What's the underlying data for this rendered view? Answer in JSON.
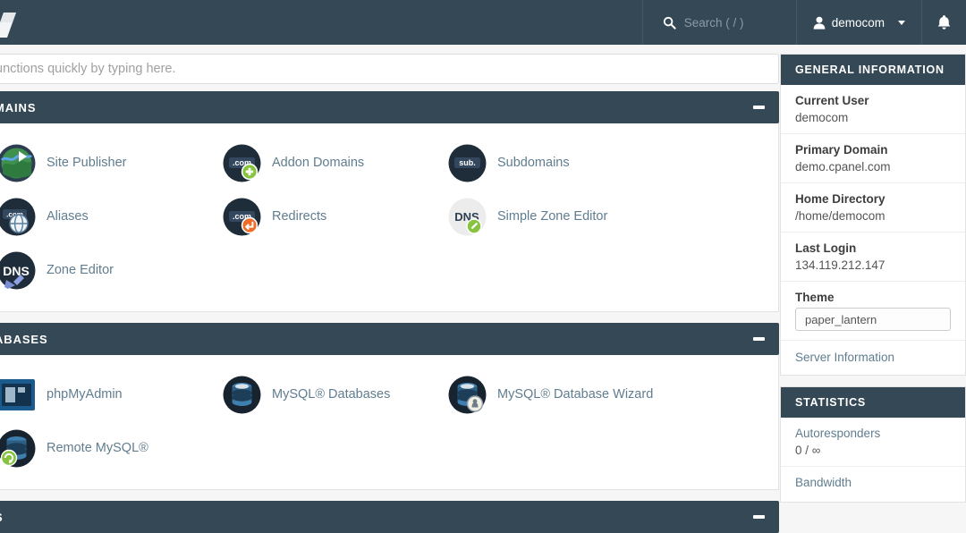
{
  "topnav": {
    "brand_icon": "cpanel-logo-icon",
    "search": {
      "icon": "search-icon",
      "placeholder": "Search ( / )"
    },
    "user": {
      "icon": "user-icon",
      "name": "democom",
      "caret_icon": "chevron-down-icon"
    },
    "notifications": {
      "icon": "bell-icon"
    }
  },
  "search_bar": {
    "placeholder": "functions quickly by typing here."
  },
  "sections": [
    {
      "title": "MAINS",
      "collapse_icon": "minus-icon",
      "tiles": [
        {
          "label": "Site Publisher",
          "icon": "site-publisher-icon"
        },
        {
          "label": "Addon Domains",
          "icon": "addon-domains-icon"
        },
        {
          "label": "Subdomains",
          "icon": "subdomains-icon"
        },
        {
          "label": "Aliases",
          "icon": "aliases-icon"
        },
        {
          "label": "Redirects",
          "icon": "redirects-icon"
        },
        {
          "label": "Simple Zone Editor",
          "icon": "simple-zone-editor-icon"
        },
        {
          "label": "Zone Editor",
          "icon": "zone-editor-icon"
        }
      ]
    },
    {
      "title": "ABASES",
      "collapse_icon": "minus-icon",
      "tiles": [
        {
          "label": "phpMyAdmin",
          "icon": "phpmyadmin-icon"
        },
        {
          "label": "MySQL® Databases",
          "icon": "mysql-databases-icon"
        },
        {
          "label": "MySQL® Database Wizard",
          "icon": "mysql-wizard-icon"
        },
        {
          "label": "Remote MySQL®",
          "icon": "remote-mysql-icon"
        }
      ]
    },
    {
      "title": "S",
      "collapse_icon": "minus-icon",
      "tiles": []
    }
  ],
  "sidebar": {
    "general_information": {
      "title": "GENERAL INFORMATION",
      "rows": [
        {
          "label": "Current User",
          "value": "democom"
        },
        {
          "label": "Primary Domain",
          "value": "demo.cpanel.com"
        },
        {
          "label": "Home Directory",
          "value": "/home/democom"
        },
        {
          "label": "Last Login",
          "value": "134.119.212.147"
        }
      ],
      "theme": {
        "label": "Theme",
        "selected": "paper_lantern"
      },
      "server_information_link": "Server Information"
    },
    "statistics": {
      "title": "STATISTICS",
      "items": [
        {
          "label": "Autoresponders",
          "value": "0 / ∞"
        },
        {
          "label": "Bandwidth",
          "value": ""
        }
      ]
    }
  },
  "colors": {
    "header_bg": "#344856",
    "page_bg": "#f6f6f6",
    "link": "#607d8f",
    "panel_bg": "#ffffff"
  }
}
